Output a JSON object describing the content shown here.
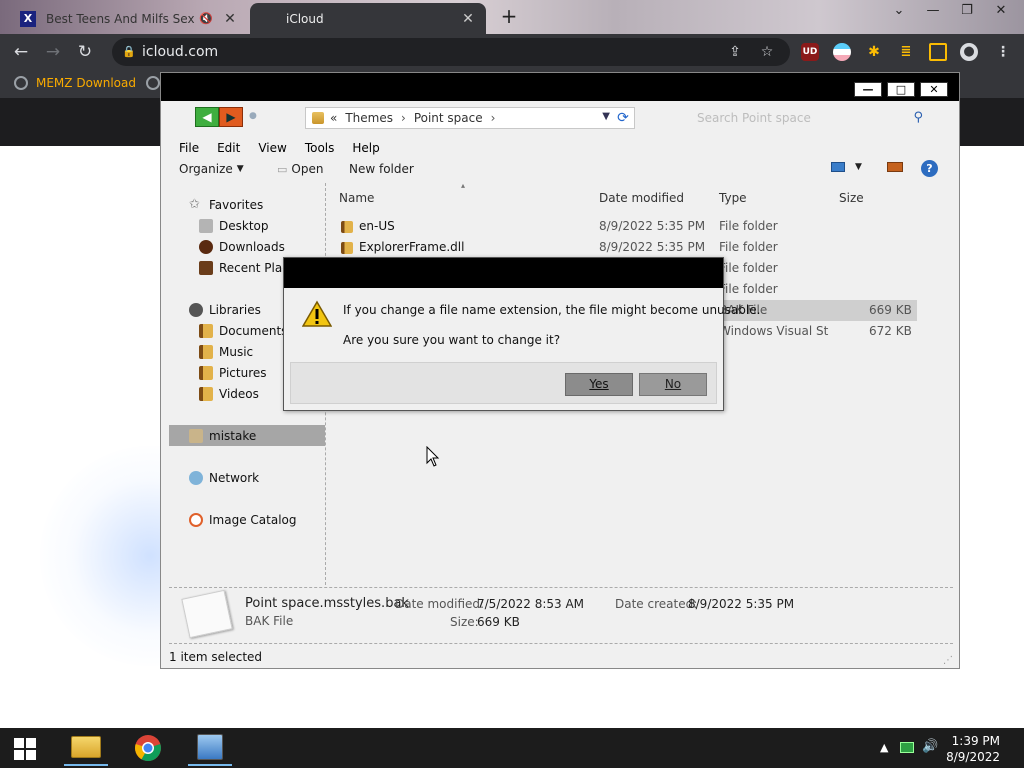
{
  "browser": {
    "tabs": [
      {
        "title": "Best Teens And Milfs Sex Co",
        "favicon": "X"
      },
      {
        "title": "iCloud"
      }
    ],
    "url": "icloud.com",
    "bookmarks": [
      "MEMZ Download"
    ],
    "extensions": [
      "UD"
    ]
  },
  "explorer": {
    "breadcrumb": {
      "prefix": "«",
      "items": [
        "Themes",
        "Point space"
      ]
    },
    "search_placeholder": "Search Point space",
    "menu": [
      "File",
      "Edit",
      "View",
      "Tools",
      "Help"
    ],
    "commands": {
      "organize": "Organize",
      "open": "Open",
      "new_folder": "New folder"
    },
    "nav": {
      "favorites": {
        "label": "Favorites",
        "items": [
          "Desktop",
          "Downloads",
          "Recent Places"
        ]
      },
      "libraries": {
        "label": "Libraries",
        "items": [
          "Documents",
          "Music",
          "Pictures",
          "Videos"
        ]
      },
      "user": "mistake",
      "network": "Network",
      "image_catalog": "Image Catalog"
    },
    "columns": {
      "name": "Name",
      "date": "Date modified",
      "type": "Type",
      "size": "Size"
    },
    "files": [
      {
        "name": "en-US",
        "date": "8/9/2022 5:35 PM",
        "type": "File folder",
        "size": ""
      },
      {
        "name": "ExplorerFrame.dll",
        "date": "8/9/2022 5:35 PM",
        "type": "File folder",
        "size": ""
      },
      {
        "name": "",
        "date": "",
        "type": "File folder",
        "size": ""
      },
      {
        "name": "",
        "date": "",
        "type": "File folder",
        "size": ""
      },
      {
        "name": "",
        "date": "",
        "type": "BAK File",
        "size": "669 KB"
      },
      {
        "name": "",
        "date": "",
        "type": "Windows Visual St...",
        "size": "672 KB"
      }
    ],
    "details": {
      "filename": "Point space.msstyles.bak",
      "filetype": "BAK File",
      "modified_label": "Date modified:",
      "modified": "7/5/2022 8:53 AM",
      "created_label": "Date created:",
      "created": "8/9/2022 5:35 PM",
      "size_label": "Size:",
      "size": "669 KB"
    },
    "status": "1 item selected"
  },
  "dialog": {
    "message": "If you change a file name extension, the file might become unusable.",
    "question": "Are you sure you want to change it?",
    "yes": "Yes",
    "no": "No"
  },
  "taskbar": {
    "time": "1:39 PM",
    "date": "8/9/2022"
  },
  "colors": {
    "chrome_toolbar": "#35363a",
    "bookmark_text": "#f9ab00",
    "selection_gray": "#a6a6a6"
  }
}
